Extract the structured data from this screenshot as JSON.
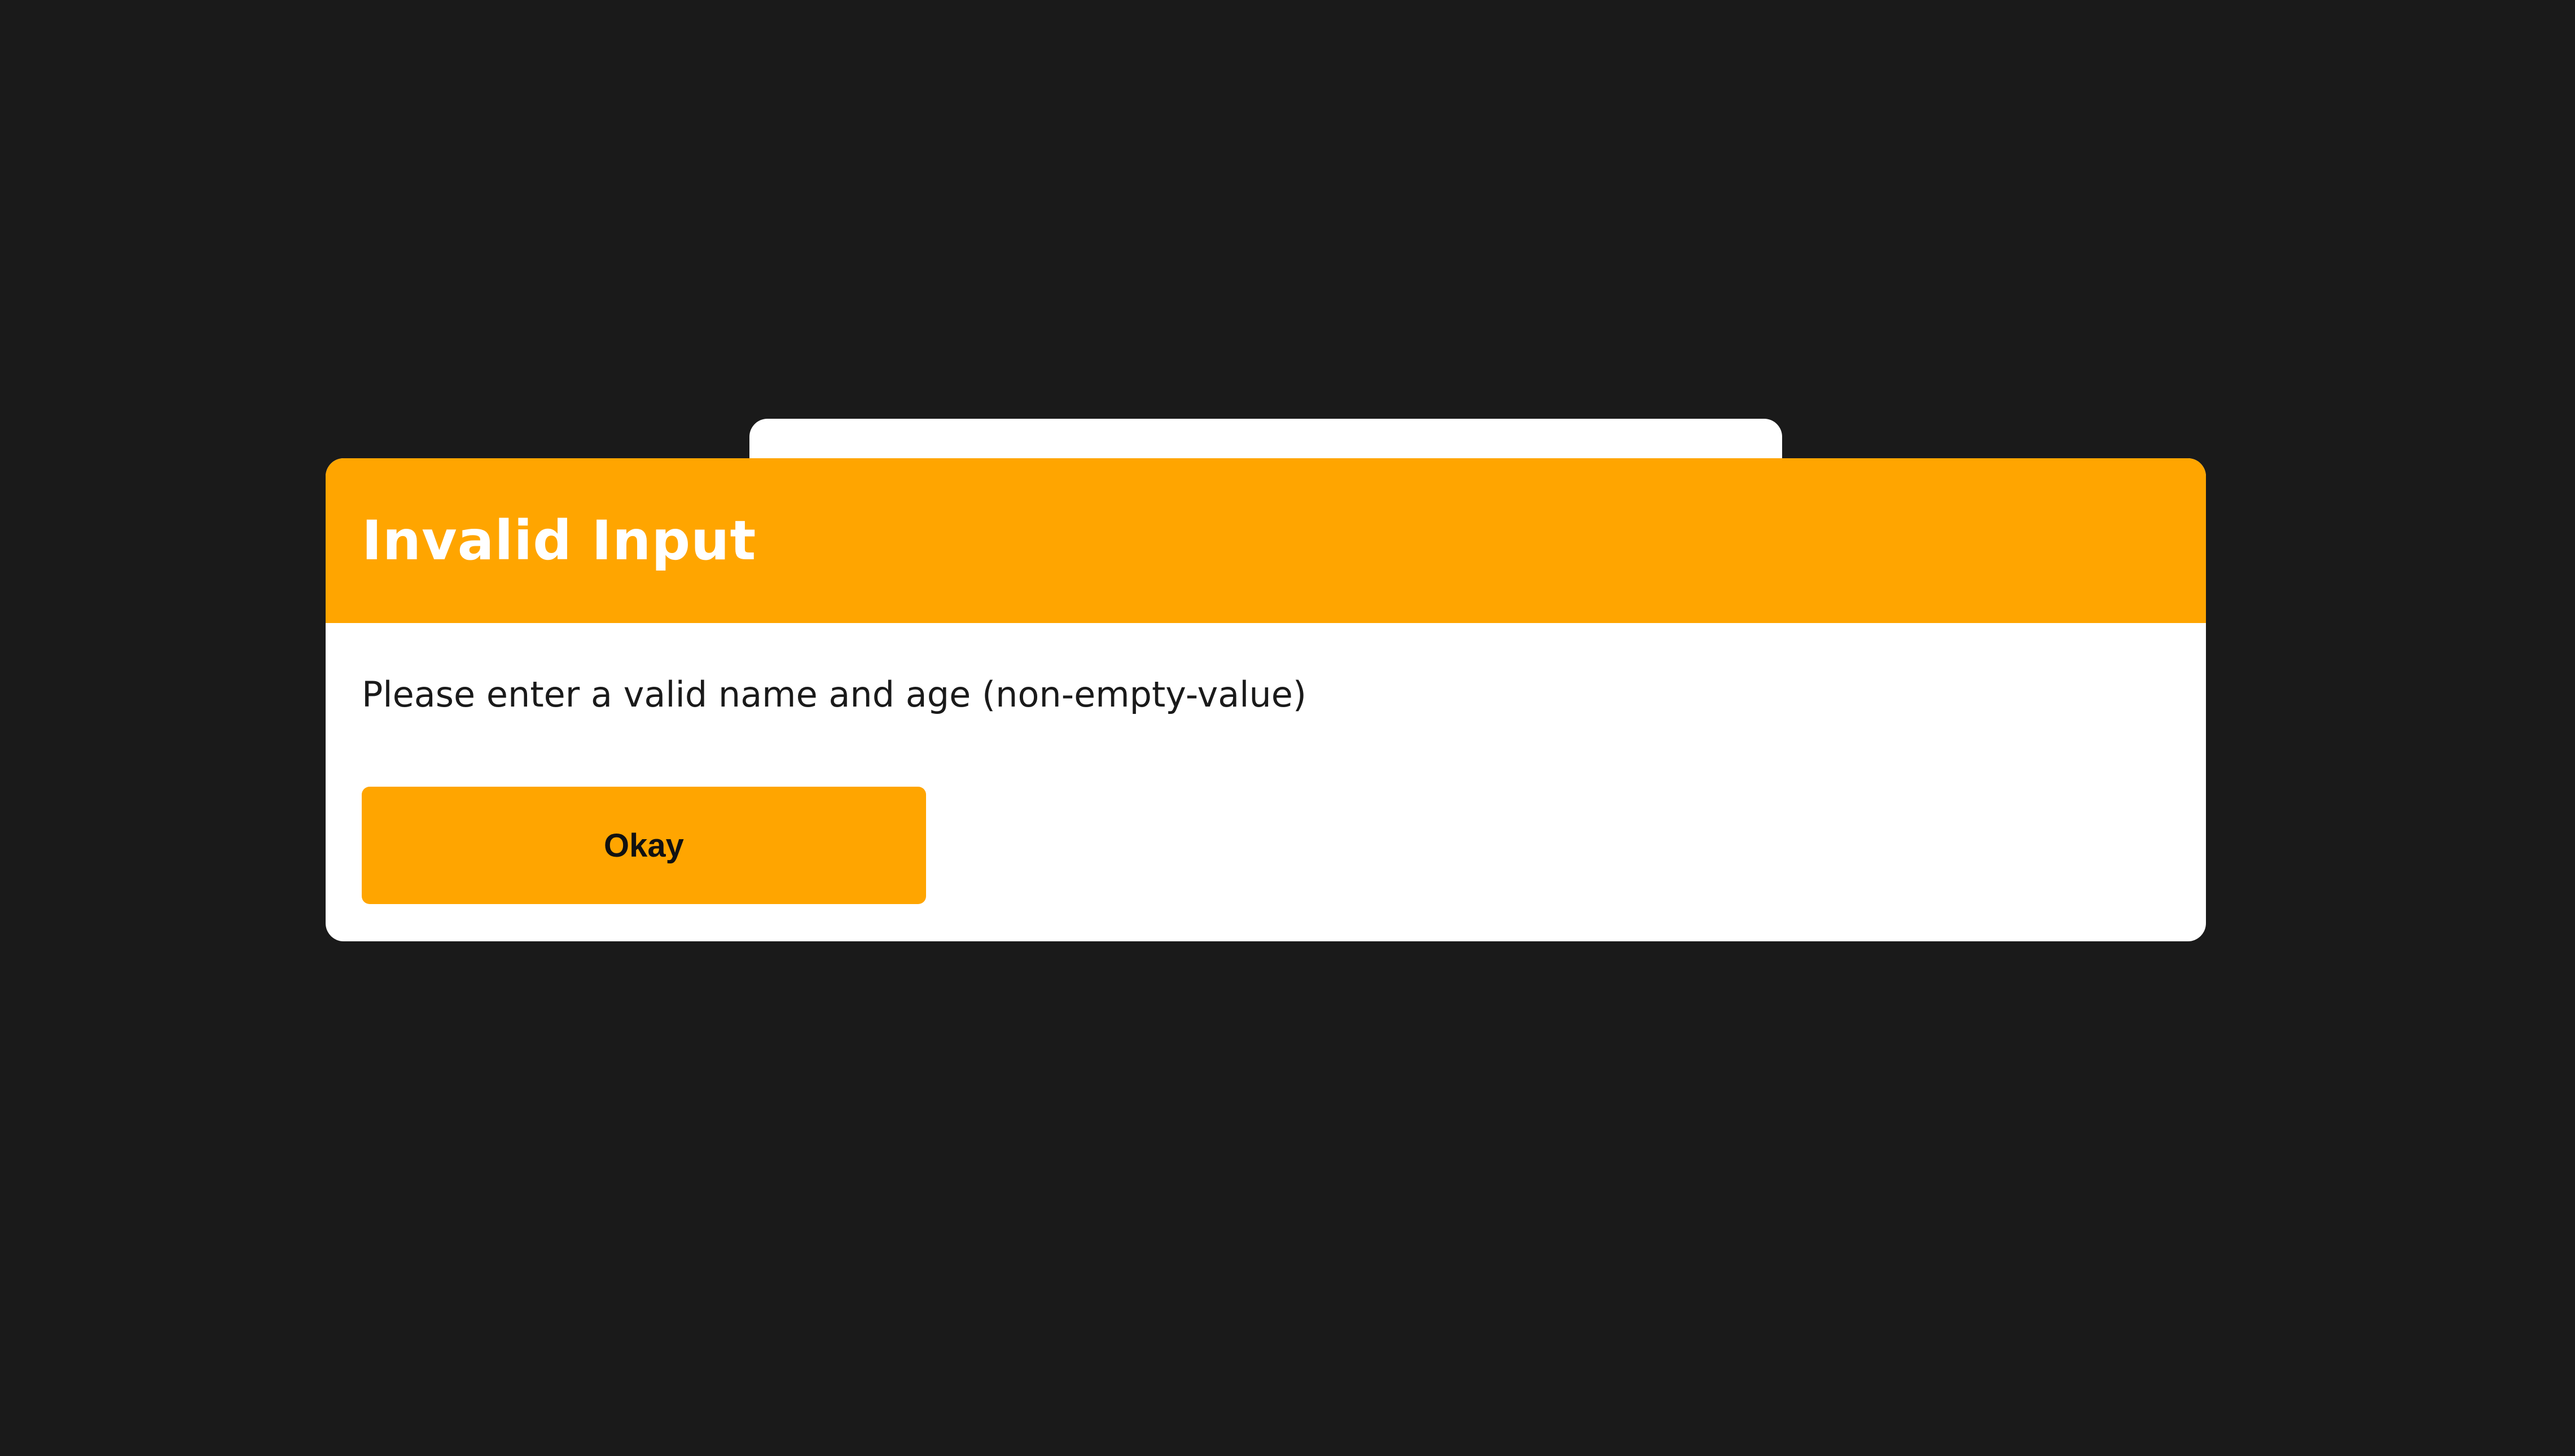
{
  "colors": {
    "background": "#1a1a1a",
    "surface": "#ffffff",
    "accent": "#ffa500",
    "title_text": "#ffffff",
    "body_text": "#1a1a1a"
  },
  "modal": {
    "title": "Invalid Input",
    "message": "Please enter a valid name and age (non-empty-value)",
    "button_label": "Okay"
  }
}
